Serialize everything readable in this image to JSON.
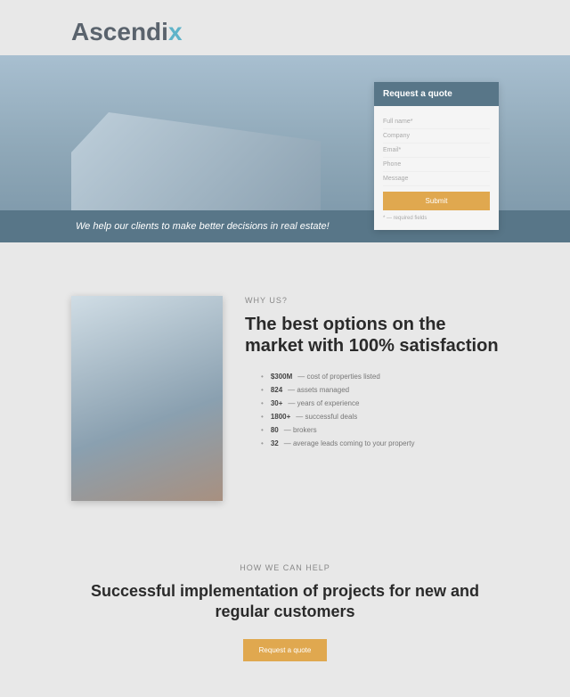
{
  "logo": {
    "part1": "Ascendi",
    "accent": "x"
  },
  "hero": {
    "tagline": "We help our clients to make better decisions in real estate!"
  },
  "quote": {
    "title": "Request a quote",
    "fields": [
      "Full name*",
      "Company",
      "Email*",
      "Phone",
      "Message"
    ],
    "submit": "Submit",
    "note": "* — required fields"
  },
  "why": {
    "label": "WHY US?",
    "title": "The best options on the market with 100% satisfaction",
    "stats": [
      {
        "value": "$300M",
        "desc": "— cost of properties listed"
      },
      {
        "value": "824",
        "desc": "— assets managed"
      },
      {
        "value": "30+",
        "desc": "— years of experience"
      },
      {
        "value": "1800+",
        "desc": "— successful deals"
      },
      {
        "value": "80",
        "desc": "— brokers"
      },
      {
        "value": "32",
        "desc": "— average leads coming to your property"
      }
    ]
  },
  "help": {
    "label": "HOW WE CAN HELP",
    "title": "Successful implementation of projects for new and regular customers",
    "button": "Request a quote"
  }
}
